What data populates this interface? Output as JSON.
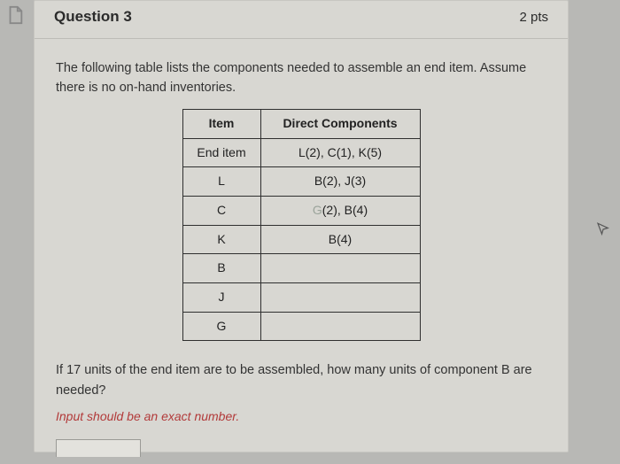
{
  "header": {
    "question_label": "Question 3",
    "points": "2 pts"
  },
  "body": {
    "intro": "The following table lists the components needed to assemble an end item. Assume there is no on-hand inventories.",
    "table": {
      "headers": {
        "item": "Item",
        "comp": "Direct Components"
      },
      "rows": [
        {
          "item": "End item",
          "comp": "L(2), C(1), K(5)"
        },
        {
          "item": "L",
          "comp": "B(2), J(3)"
        },
        {
          "item": "C",
          "comp_prefix": "G",
          "comp_suffix": "(2), B(4)"
        },
        {
          "item": "K",
          "comp": "B(4)"
        },
        {
          "item": "B",
          "comp": ""
        },
        {
          "item": "J",
          "comp": ""
        },
        {
          "item": "G",
          "comp": ""
        }
      ]
    },
    "question": "If 17 units of the end item are to be assembled, how many units of component B are needed?",
    "hint": "Input should be an exact number."
  },
  "icons": {
    "page": "page-icon",
    "cursor": "cursor-icon"
  }
}
